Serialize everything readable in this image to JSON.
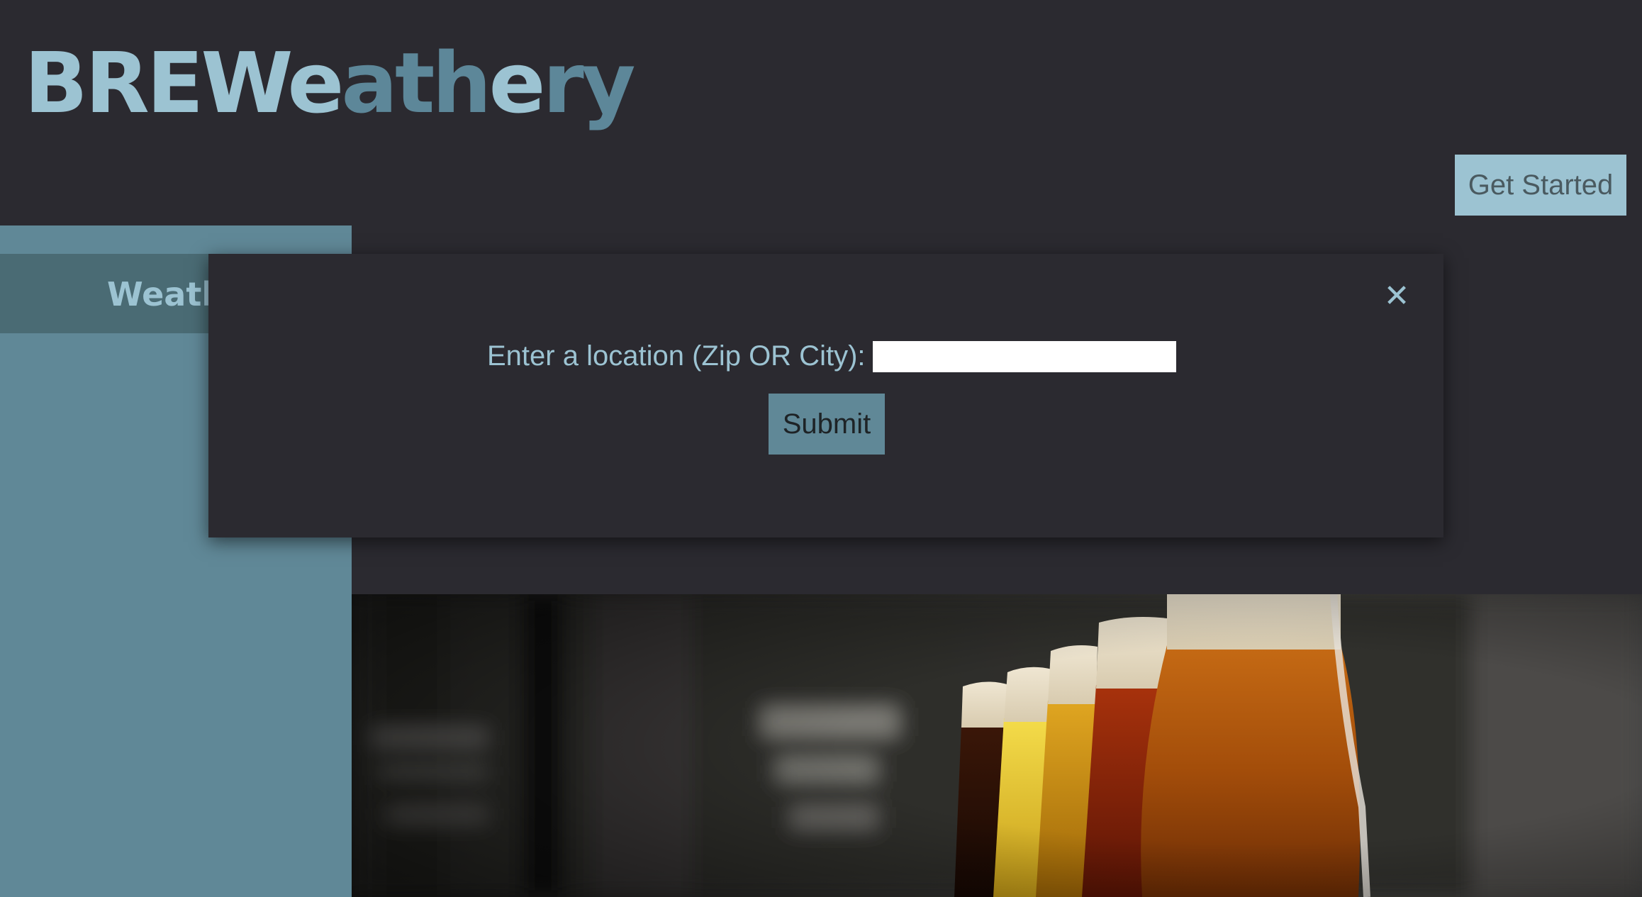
{
  "header": {
    "logo_part1": "BREWe",
    "logo_part2": "ath",
    "logo_part3": "e",
    "logo_part4": "ry",
    "get_started_label": "Get Started"
  },
  "sidebar": {
    "tab_label": "Weath"
  },
  "modal": {
    "close_symbol": "✕",
    "location_label": "Enter a location (Zip OR City):",
    "location_value": "",
    "submit_label": "Submit"
  },
  "colors": {
    "background": "#2b2a30",
    "accent_light": "#9cc3d2",
    "accent_dark": "#608897",
    "tab_dark": "#4a6b74"
  }
}
